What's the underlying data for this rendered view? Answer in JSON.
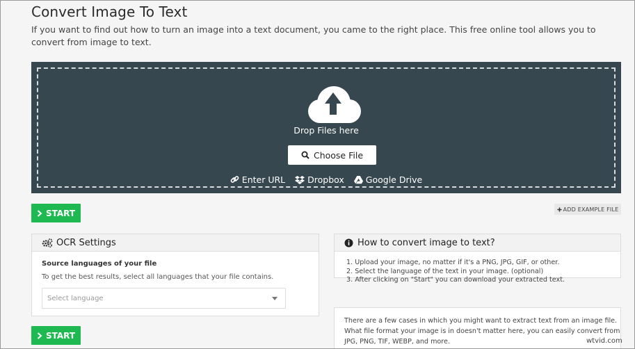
{
  "page": {
    "title": "Convert Image To Text",
    "intro": "If you want to find out how to turn an image into a text document, you came to the right place. This free online tool allows you to convert from image to text."
  },
  "dropzone": {
    "drop_text": "Drop Files here",
    "choose_label": "Choose File",
    "sources": [
      {
        "label": "Enter URL",
        "icon": "link-icon"
      },
      {
        "label": "Dropbox",
        "icon": "dropbox-icon"
      },
      {
        "label": "Google Drive",
        "icon": "google-drive-icon"
      }
    ],
    "background": "#37474f"
  },
  "actions": {
    "start_label": "START",
    "add_example_label": "ADD EXAMPLE FILE",
    "start_color": "#1fb951"
  },
  "ocr_settings": {
    "heading": "OCR Settings",
    "source_label": "Source languages of your file",
    "source_help": "To get the best results, select all languages that your file contains.",
    "language_placeholder": "Select language"
  },
  "howto": {
    "heading": "How to convert image to text?",
    "steps": [
      "1. Upload your image, no matter if it's a PNG, JPG, GIF, or other.",
      "2. Select the language of the text in your image. (optional)",
      "3. After clicking on \"Start\" you can download your extracted text."
    ]
  },
  "cases": {
    "text": "There are a few cases in which you might want to extract text from an image file. What file format your image is in doesn't matter here, you can easily convert from JPG, PNG, TIF, WEBP, and more."
  },
  "watermark": "wtvid.com"
}
